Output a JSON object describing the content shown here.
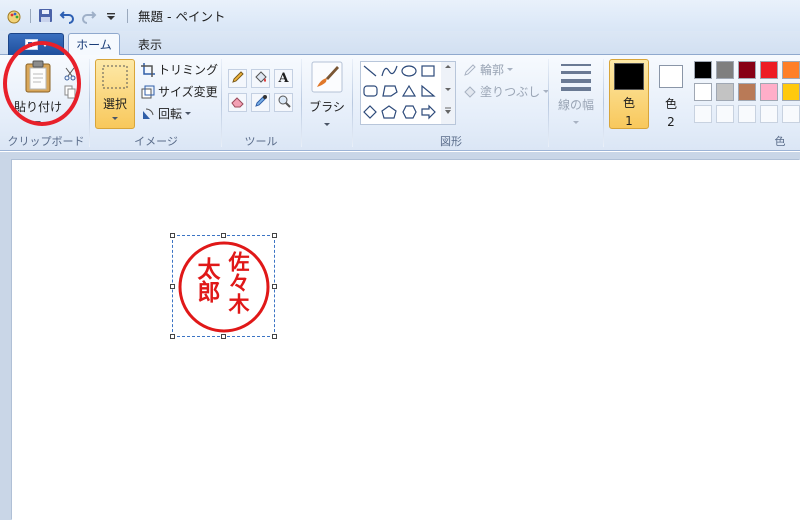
{
  "window": {
    "title": "無題 - ペイント"
  },
  "tabs": {
    "home": "ホーム",
    "view": "表示"
  },
  "clipboard": {
    "paste_label": "貼り付け",
    "group_label": "クリップボード"
  },
  "image": {
    "select_label": "選択",
    "crop_label": "トリミング",
    "resize_label": "サイズ変更",
    "rotate_label": "回転",
    "group_label": "イメージ"
  },
  "tools": {
    "group_label": "ツール"
  },
  "brush": {
    "label": "ブラシ"
  },
  "shapes": {
    "outline_label": "輪郭",
    "fill_label": "塗りつぶし",
    "group_label": "図形"
  },
  "size": {
    "label": "線の幅"
  },
  "colors": {
    "color1_label": "色",
    "color1_num": "1",
    "color2_label": "色",
    "color2_num": "2",
    "group_label": "色",
    "color1_value": "#000000",
    "color2_value": "#ffffff",
    "palette_row1": [
      "#000000",
      "#7f7f7f",
      "#880015",
      "#ed1c24",
      "#ff7f27"
    ],
    "palette_row2": [
      "#ffffff",
      "#c3c3c3",
      "#b97a57",
      "#ffaec9",
      "#ffc90e"
    ]
  },
  "stamp": {
    "chars_right": "佐々木",
    "chars_left": "太郎",
    "color": "#e01818"
  }
}
